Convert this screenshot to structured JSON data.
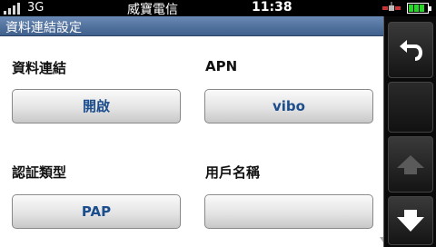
{
  "status": {
    "network": "3G",
    "carrier": "威寶電信",
    "time": "11:38"
  },
  "title": "資料連結設定",
  "fields": {
    "data_link": {
      "label": "資料連結",
      "value": "開啟"
    },
    "apn": {
      "label": "APN",
      "value": "vibo"
    },
    "auth_type": {
      "label": "認証類型",
      "value": "PAP"
    },
    "username": {
      "label": "用戶名稱",
      "value": ""
    }
  },
  "icons": {
    "back": "back-arrow-icon",
    "up": "up-arrow-icon",
    "down": "down-arrow-icon",
    "satellite": "satellite-icon",
    "battery": "battery-icon",
    "signal": "signal-icon"
  },
  "colors": {
    "title_bar": "#4f70a0",
    "button_text": "#1c4d8c",
    "battery_fill": "#28d628"
  }
}
